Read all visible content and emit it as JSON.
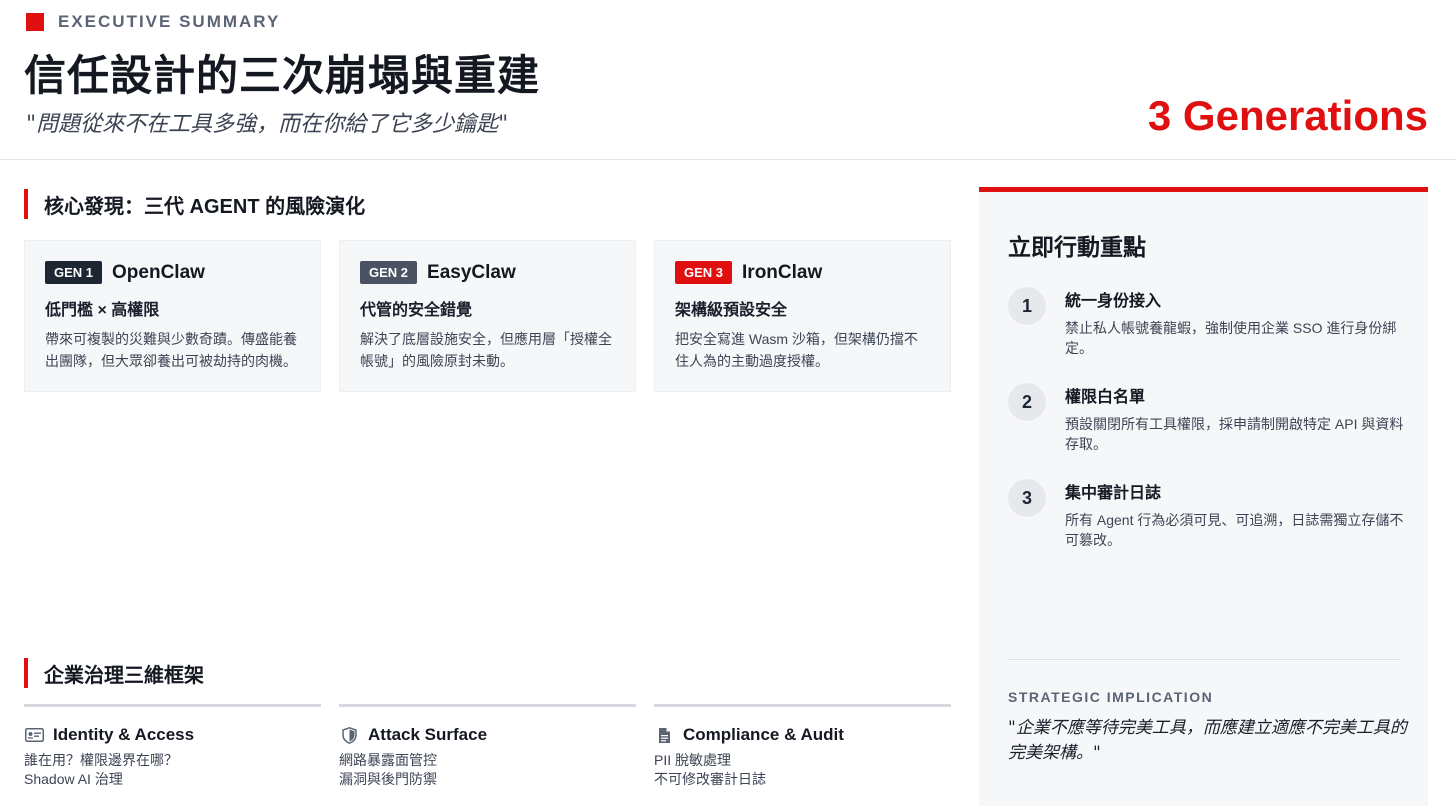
{
  "header": {
    "eyebrow": "EXECUTIVE SUMMARY",
    "title": "信任設計的三次崩塌與重建",
    "subtitle": "\"問題從來不在工具多強，而在你給了它多少鑰匙\"",
    "metric": "3 Generations"
  },
  "findings": {
    "heading": "核心發現：三代 AGENT 的風險演化",
    "cards": [
      {
        "badge": "GEN 1",
        "name": "OpenClaw",
        "headline": "低門檻 × 高權限",
        "body": "帶來可複製的災難與少數奇蹟。傳盛能養出團隊，但大眾卻養出可被劫持的肉機。"
      },
      {
        "badge": "GEN 2",
        "name": "EasyClaw",
        "headline": "代管的安全錯覺",
        "body": "解決了底層設施安全，但應用層「授權全帳號」的風險原封未動。"
      },
      {
        "badge": "GEN 3",
        "name": "IronClaw",
        "headline": "架構級預設安全",
        "body": "把安全寫進 Wasm 沙箱，但架構仍擋不住人為的主動過度授權。"
      }
    ],
    "badge_colors": [
      "#1f2633",
      "#4b5363",
      "#e01010"
    ]
  },
  "framework": {
    "heading": "企業治理三維框架",
    "columns": [
      {
        "icon": "id-card-icon",
        "name": "Identity & Access",
        "lines": [
          "誰在用？權限邊界在哪？",
          "Shadow AI 治理"
        ]
      },
      {
        "icon": "shield-icon",
        "name": "Attack Surface",
        "lines": [
          "網路暴露面管控",
          "漏洞與後門防禦"
        ]
      },
      {
        "icon": "document-icon",
        "name": "Compliance & Audit",
        "lines": [
          "PII 脫敏處理",
          "不可修改審計日誌"
        ]
      }
    ]
  },
  "actions": {
    "title": "立即行動重點",
    "steps": [
      {
        "num": "1",
        "title": "統一身份接入",
        "desc": "禁止私人帳號養龍蝦，強制使用企業 SSO 進行身份綁定。"
      },
      {
        "num": "2",
        "title": "權限白名單",
        "desc": "預設關閉所有工具權限，採申請制開啟特定 API 與資料存取。"
      },
      {
        "num": "3",
        "title": "集中審計日誌",
        "desc": "所有 Agent 行為必須可見、可追溯，日誌需獨立存儲不可篡改。"
      }
    ],
    "implication_label": "STRATEGIC IMPLICATION",
    "implication_quote": "\"企業不應等待完美工具，而應建立適應不完美工具的完美架構。\""
  },
  "colors": {
    "accent": "#e01010",
    "panel_bg": "#f6f7f9",
    "card_bg": "#f6f7f9"
  }
}
